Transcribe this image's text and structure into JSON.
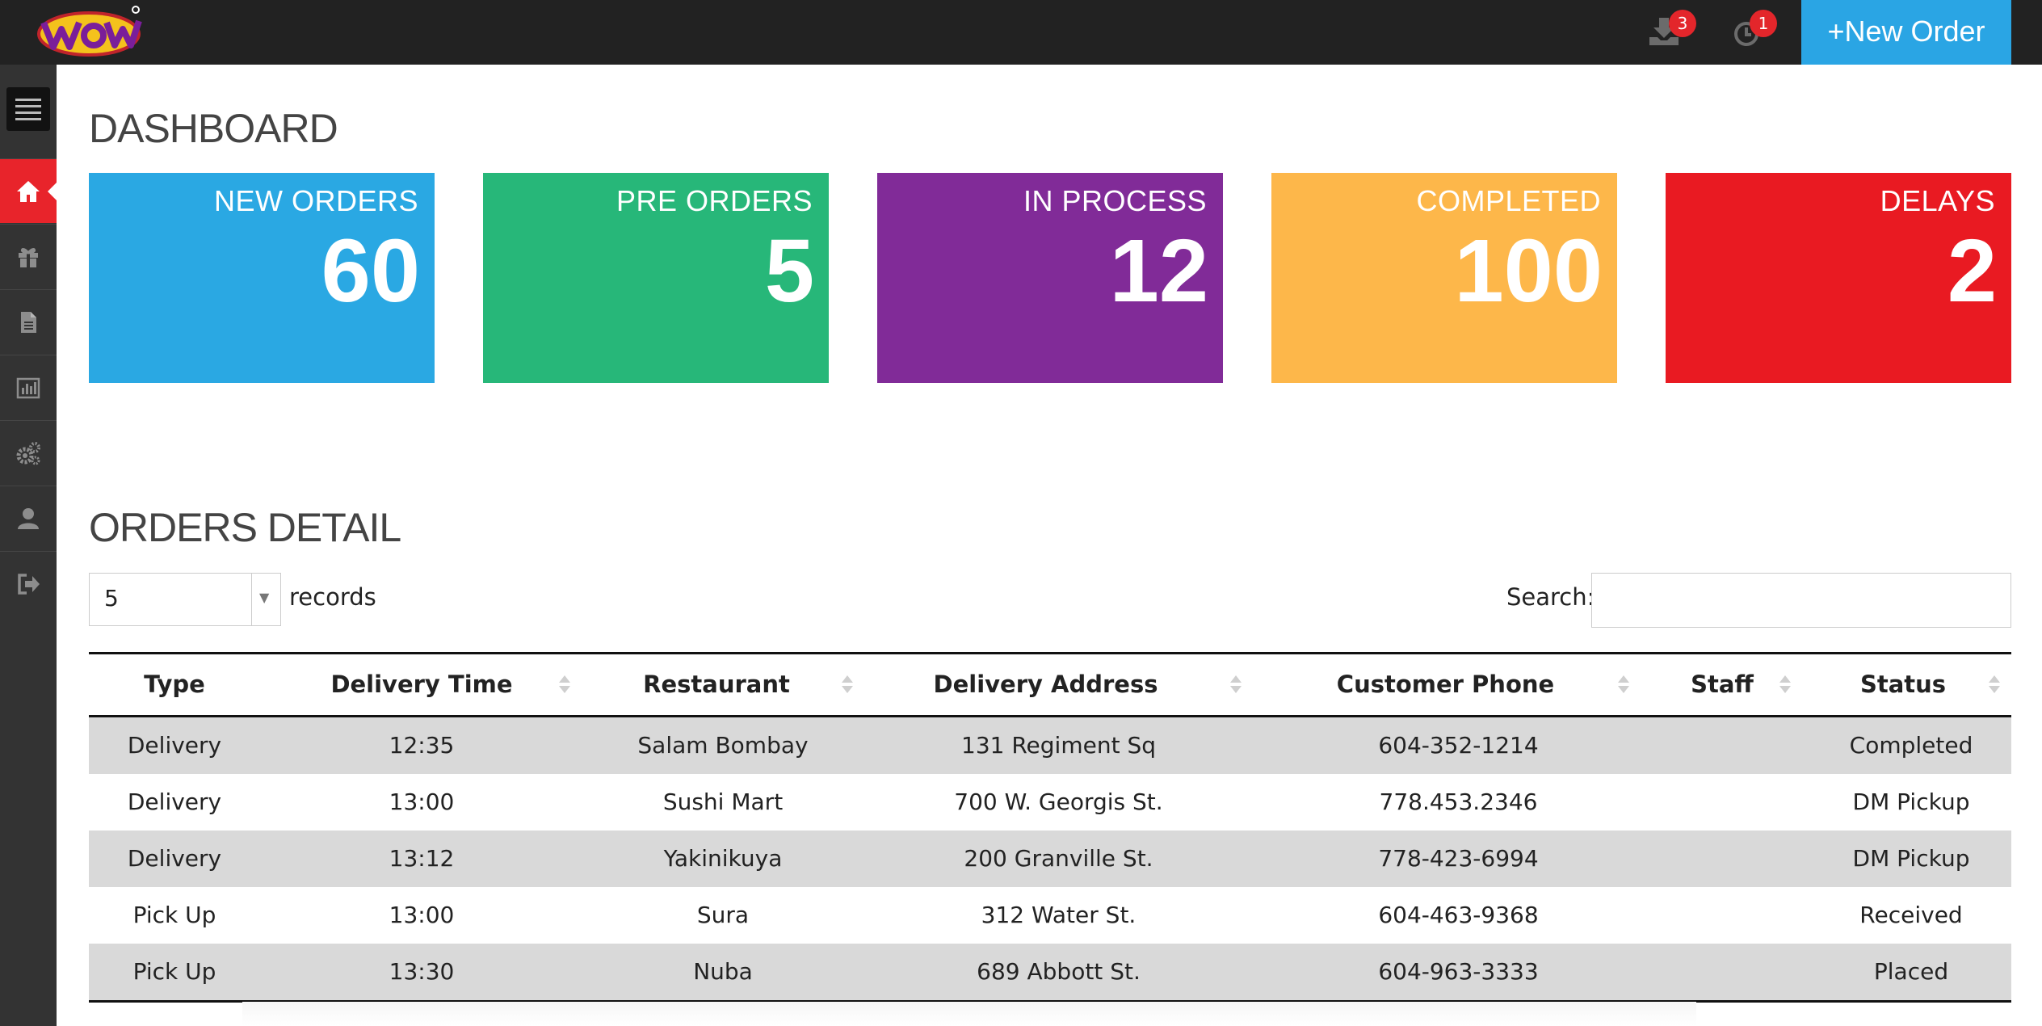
{
  "brand": {
    "logo_text": "wow",
    "logo_icon": "wow-logo"
  },
  "topbar": {
    "download_badge": "3",
    "clock_badge": "1",
    "new_order_label": "+New Order",
    "icons": [
      "download-icon",
      "clock-icon"
    ]
  },
  "sidebar": {
    "items": [
      {
        "icon": "home-icon",
        "active": true
      },
      {
        "icon": "gift-icon"
      },
      {
        "icon": "document-icon"
      },
      {
        "icon": "bar-chart-icon"
      },
      {
        "icon": "gears-icon"
      },
      {
        "icon": "user-icon"
      },
      {
        "icon": "sign-out-icon"
      }
    ]
  },
  "dashboard": {
    "title": "DASHBOARD",
    "cards": [
      {
        "label": "NEW ORDERS",
        "value": "60",
        "color": "#2aa8e3"
      },
      {
        "label": "PRE ORDERS",
        "value": "5",
        "color": "#27b779"
      },
      {
        "label": "IN PROCESS",
        "value": "12",
        "color": "#812b98"
      },
      {
        "label": "COMPLETED",
        "value": "100",
        "color": "#fdb74a"
      },
      {
        "label": "DELAYS",
        "value": "2",
        "color": "#e91a22"
      }
    ]
  },
  "orders": {
    "title": "ORDERS DETAIL",
    "page_length": "5",
    "records_label": "records",
    "search_label": "Search:",
    "search_value": "",
    "columns": [
      "Type",
      "Delivery Time",
      "Restaurant",
      "Delivery Address",
      "Customer Phone",
      "Staff",
      "Status"
    ],
    "rows": [
      [
        "Delivery",
        "12:35",
        "Salam Bombay",
        "131 Regiment Sq",
        "604-352-1214",
        "",
        "Completed"
      ],
      [
        "Delivery",
        "13:00",
        "Sushi Mart",
        "700 W. Georgis St.",
        "778.453.2346",
        "",
        "DM Pickup"
      ],
      [
        "Delivery",
        "13:12",
        "Yakinikuya",
        "200 Granville St.",
        "778-423-6994",
        "",
        "DM Pickup"
      ],
      [
        "Pick Up",
        "13:00",
        "Sura",
        "312 Water St.",
        "604-463-9368",
        "",
        "Received"
      ],
      [
        "Pick Up",
        "13:30",
        "Nuba",
        "689 Abbott St.",
        "604-963-3333",
        "",
        "Placed"
      ]
    ]
  }
}
